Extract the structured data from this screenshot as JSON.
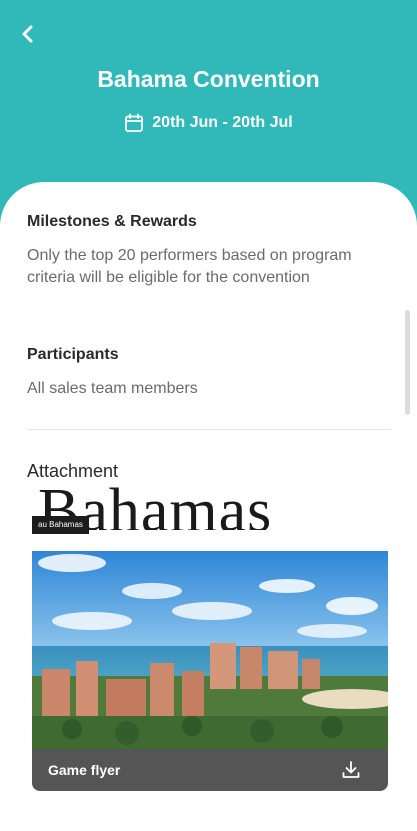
{
  "header": {
    "title": "Bahama Convention",
    "date_range": "20th Jun - 20th Jul",
    "colors": {
      "background": "#30b9b8",
      "text": "#ffffff"
    }
  },
  "milestones": {
    "heading": "Milestones & Rewards",
    "text": "Only the top 20 performers based on program criteria will be eligible for the convention"
  },
  "participants": {
    "heading": "Participants",
    "text": "All sales team members"
  },
  "attachment": {
    "heading": "Attachment",
    "banner_text": "Bahamas",
    "banner_tag": "au Bahamas",
    "card_title": "Game flyer"
  },
  "icons": {
    "back": "chevron-left-icon",
    "calendar": "calendar-icon",
    "download": "download-icon"
  }
}
